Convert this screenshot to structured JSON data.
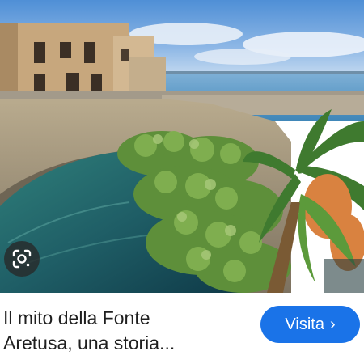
{
  "result": {
    "title_line1": "Il mito della Fonte",
    "title_line2": "Aretusa, una storia...",
    "visit_label": "Visita",
    "visit_chevron": "›",
    "lens_icon": "google-lens-icon",
    "visit_button_color": "#1a73e8"
  }
}
